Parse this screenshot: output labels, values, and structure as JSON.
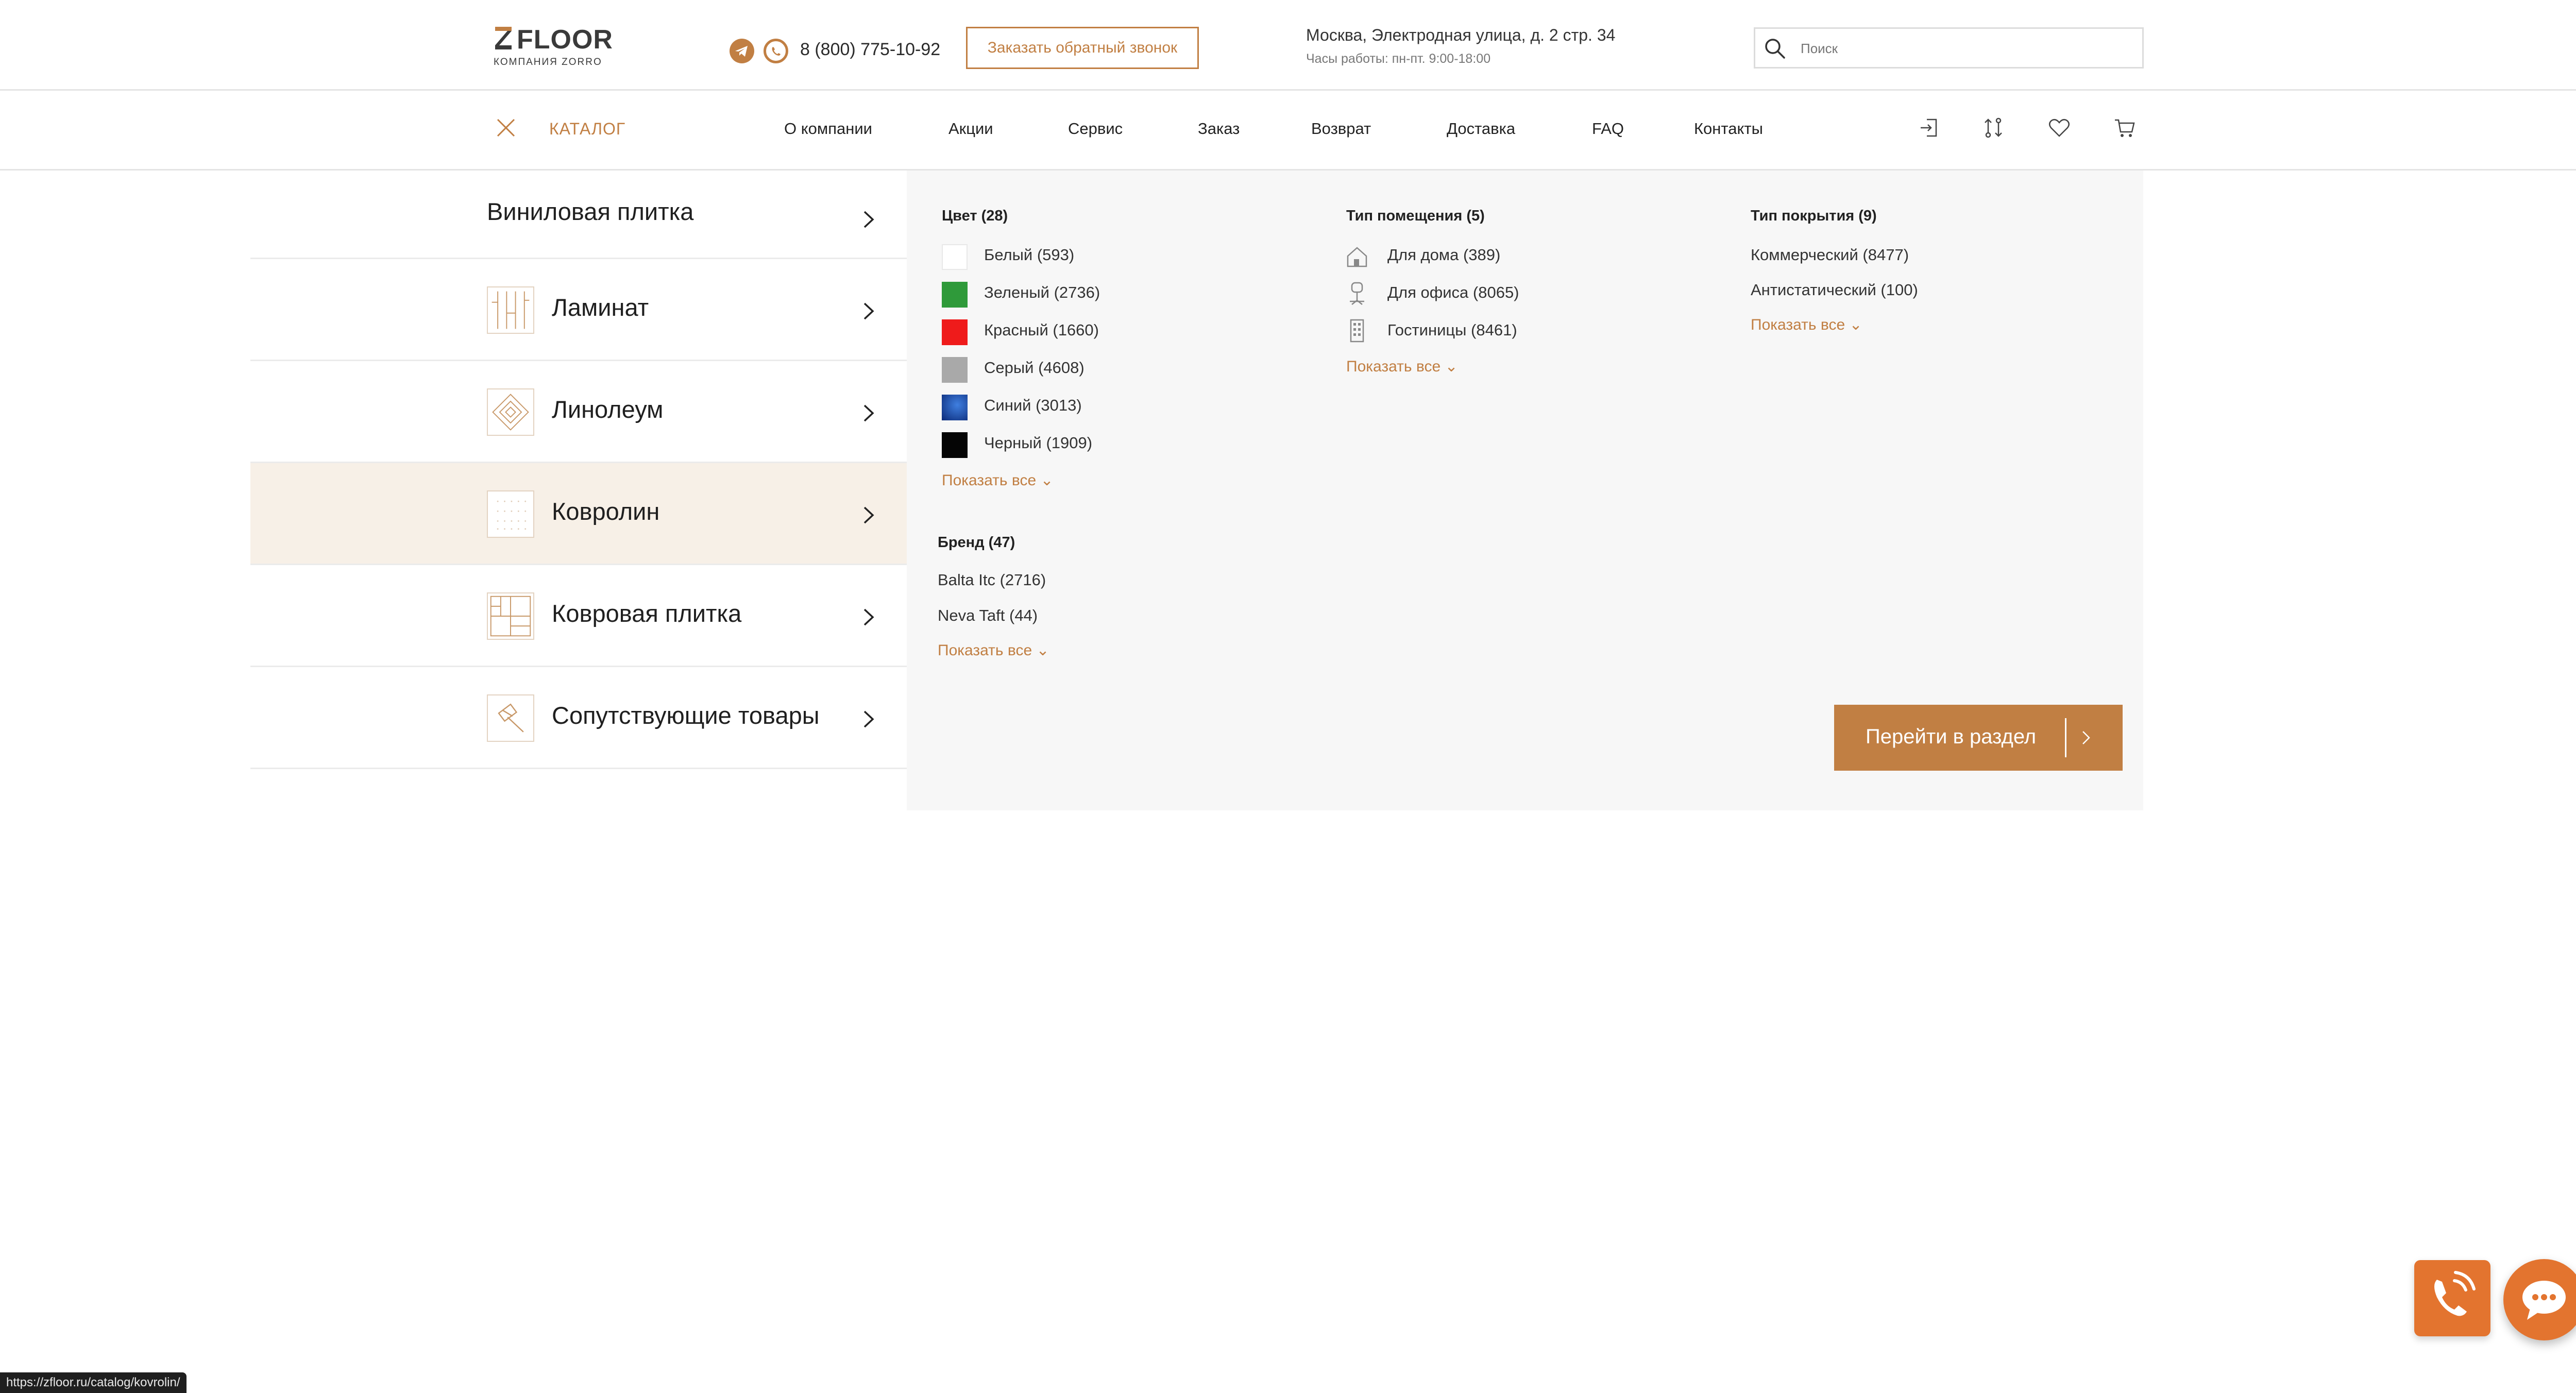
{
  "header": {
    "logo_text": "FLOOR",
    "logo_subtitle": "КОМПАНИЯ ZORRO",
    "phone": "8 (800) 775-10-92",
    "callback_button": "Заказать обратный звонок",
    "address": "Москва, Электродная улица, д. 2 стр. 34",
    "hours": "Часы работы: пн-пт. 9:00-18:00",
    "search_placeholder": "Поиск"
  },
  "nav": {
    "catalog_label": "КАТАЛОГ",
    "links": [
      "О компании",
      "Акции",
      "Сервис",
      "Заказ",
      "Возврат",
      "Доставка",
      "FAQ",
      "Контакты"
    ],
    "icons": [
      "login-icon",
      "compare-icon",
      "heart-icon",
      "cart-icon"
    ]
  },
  "categories": [
    {
      "label": "Виниловая плитка",
      "active": false
    },
    {
      "label": "Ламинат",
      "active": false
    },
    {
      "label": "Линолеум",
      "active": false
    },
    {
      "label": "Ковролин",
      "active": true
    },
    {
      "label": "Ковровая плитка",
      "active": false
    },
    {
      "label": "Сопутствующие товары",
      "active": false
    }
  ],
  "filters": {
    "color": {
      "title": "Цвет (28)",
      "items": [
        {
          "label": "Белый (593)",
          "color": "#ffffff"
        },
        {
          "label": "Зеленый (2736)",
          "color": "#2f9a3a"
        },
        {
          "label": "Красный (1660)",
          "color": "#ef1b1b"
        },
        {
          "label": "Серый (4608)",
          "color": "#a9a9a9"
        },
        {
          "label": "Синий (3013)",
          "color": "#1747a8"
        },
        {
          "label": "Черный (1909)",
          "color": "#050505"
        }
      ],
      "more": "Показать все"
    },
    "room_type": {
      "title": "Тип помещения (5)",
      "items": [
        {
          "label": "Для дома (389)",
          "icon": "house-icon"
        },
        {
          "label": "Для офиса (8065)",
          "icon": "office-chair-icon"
        },
        {
          "label": "Гостиницы (8461)",
          "icon": "hotel-icon"
        }
      ],
      "more": "Показать все"
    },
    "coating_type": {
      "title": "Тип покрытия (9)",
      "items": [
        "Коммерческий (8477)",
        "Антистатический (100)"
      ],
      "more": "Показать все"
    },
    "brand": {
      "title": "Бренд (47)",
      "items": [
        "Balta Itc (2716)",
        "Neva Taft (44)"
      ],
      "more": "Показать все"
    }
  },
  "go_section_button": "Перейти в раздел",
  "status_url": "https://zfloor.ru/catalog/kovrolin/",
  "colors": {
    "accent": "#c17f43",
    "active_row": "#f7f0e7",
    "panel_bg": "#f7f7f7",
    "fab": "#e3742f"
  }
}
